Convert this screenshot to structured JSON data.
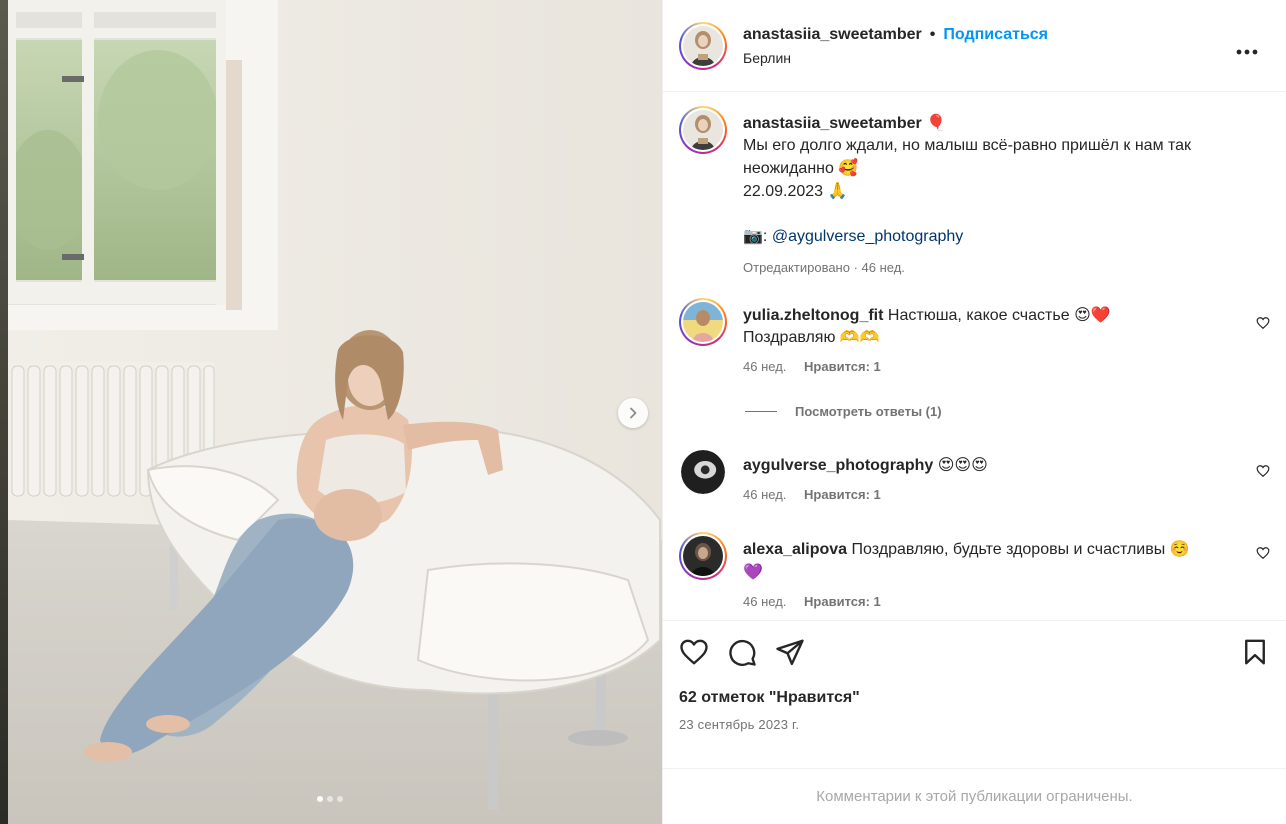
{
  "post": {
    "author": "anastasiia_sweetamber",
    "separator": "•",
    "follow_label": "Подписаться",
    "location": "Берлин",
    "more_label": "•••"
  },
  "caption": {
    "author": "anastasiia_sweetamber",
    "author_emoji": "🎈",
    "line1": "Мы его долго ждали, но малыш всё-равно пришёл к нам так неожиданно",
    "line1_emoji": "🥰",
    "line2": "22.09.2023",
    "line2_emoji": "🙏",
    "camera_emoji": "📷",
    "colon": ":",
    "mention": "@aygulverse_photography",
    "edited": "Отредактировано · 46 нед."
  },
  "comments": [
    {
      "author": "yulia.zheltonog_fit",
      "text": "Настюша, какое счастье",
      "emoji": "😍❤️",
      "text2": "Поздравляю 🫶🫶",
      "time": "46 нед.",
      "likes": "Нравится: 1"
    },
    {
      "author": "aygulverse_photography",
      "text": "",
      "emoji": "😍😍😍",
      "time": "46 нед.",
      "likes": "Нравится: 1"
    },
    {
      "author": "alexa_alipova",
      "text": "Поздравляю, будьте здоровы и счастливы",
      "emoji": "☺️",
      "text2": "💜",
      "time": "46 нед.",
      "likes": "Нравится: 1"
    }
  ],
  "view_replies": "Посмотреть ответы (1)",
  "likes_count": "62 отметок \"Нравится\"",
  "post_date": "23 сентябрь 2023 г.",
  "comments_restricted": "Комментарии к этой публикации ограничены.",
  "carousel": {
    "total": 3,
    "active": 1
  },
  "colors": {
    "accent": "#0095f6",
    "text": "#262626",
    "muted": "#737373",
    "mention": "#00376b"
  }
}
